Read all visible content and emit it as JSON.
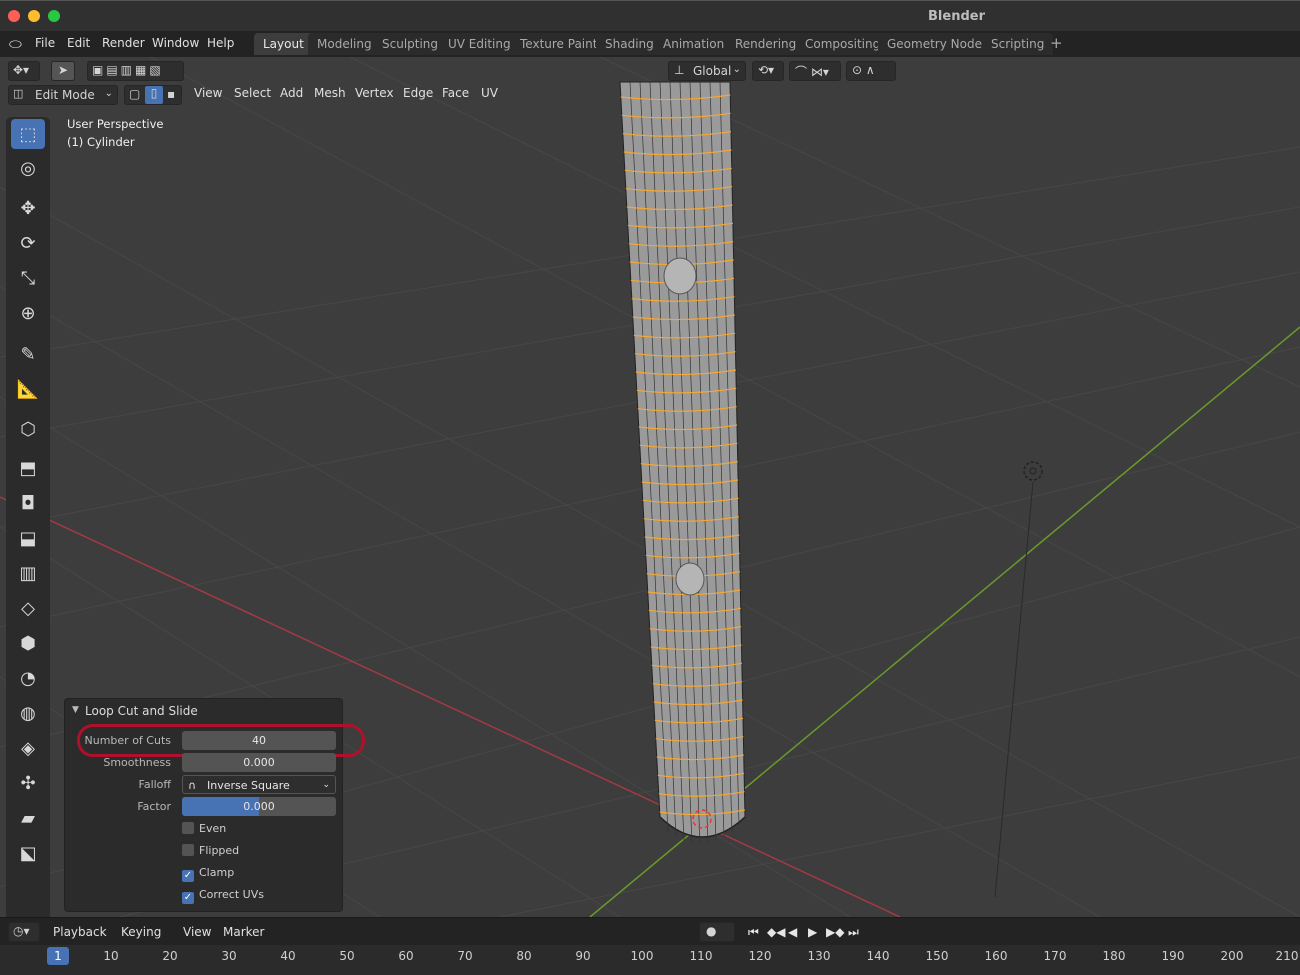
{
  "window": {
    "title": "Blender",
    "traffic_colors": [
      "#ff5f57",
      "#febc2e",
      "#28c840"
    ]
  },
  "menubar": {
    "items": [
      "File",
      "Edit",
      "Render",
      "Window",
      "Help"
    ],
    "workspaces": [
      "Layout",
      "Modeling",
      "Sculpting",
      "UV Editing",
      "Texture Paint",
      "Shading",
      "Animation",
      "Rendering",
      "Compositing",
      "Geometry Nodes",
      "Scripting"
    ],
    "active_workspace": "Layout",
    "add_tab": "+"
  },
  "viewport_header": {
    "transform_orientation": "Global",
    "mode": "Edit Mode",
    "menus": [
      "View",
      "Select",
      "Add",
      "Mesh",
      "Vertex",
      "Edge",
      "Face",
      "UV"
    ]
  },
  "viewport": {
    "perspective_label": "User Perspective",
    "object_label": "(1) Cylinder",
    "colors": {
      "background": "#3d3d3d",
      "grid": "#474747",
      "x_axis": "#a33a45",
      "y_axis": "#6a9a2a",
      "edge_highlight": "#f5a733",
      "mesh": "#9a9a9a"
    }
  },
  "operator_panel": {
    "title": "Loop Cut and Slide",
    "fields": [
      {
        "label": "Number of Cuts",
        "value": "40"
      },
      {
        "label": "Smoothness",
        "value": "0.000"
      },
      {
        "label": "Falloff",
        "value": "Inverse Square"
      },
      {
        "label": "Factor",
        "value": "0.000"
      }
    ],
    "checkboxes": [
      {
        "label": "Even",
        "checked": false
      },
      {
        "label": "Flipped",
        "checked": false
      },
      {
        "label": "Clamp",
        "checked": true
      },
      {
        "label": "Correct UVs",
        "checked": true
      }
    ],
    "highlight_color": "#b0102a"
  },
  "timeline": {
    "menus": [
      "Playback",
      "Keying",
      "View",
      "Marker"
    ],
    "current_frame": "1",
    "ticks": [
      "10",
      "20",
      "30",
      "40",
      "50",
      "60",
      "70",
      "80",
      "90",
      "100",
      "110",
      "120",
      "130",
      "140",
      "150",
      "160",
      "170",
      "180",
      "190",
      "200",
      "210"
    ]
  }
}
